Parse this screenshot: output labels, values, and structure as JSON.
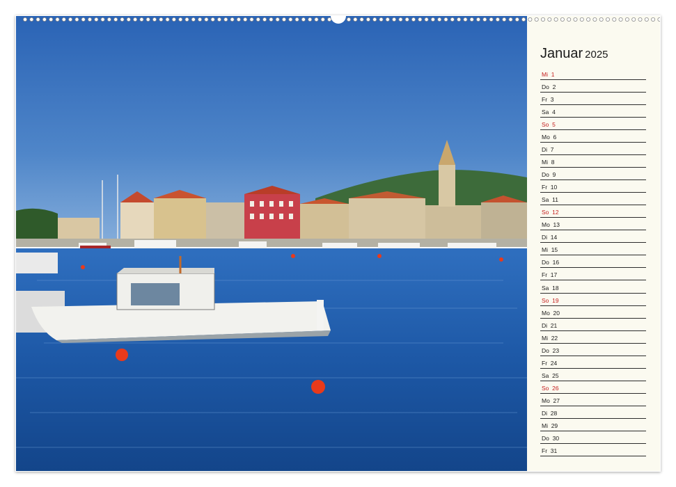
{
  "calendar": {
    "month": "Januar",
    "year": "2025",
    "accent_color": "#c41e1e",
    "days": [
      {
        "label": "Mi  1",
        "type": "holiday"
      },
      {
        "label": "Do  2",
        "type": "normal"
      },
      {
        "label": "Fr  3",
        "type": "normal"
      },
      {
        "label": "Sa  4",
        "type": "normal"
      },
      {
        "label": "So  5",
        "type": "sunday"
      },
      {
        "label": "Mo  6",
        "type": "normal"
      },
      {
        "label": "Di  7",
        "type": "normal"
      },
      {
        "label": "Mi  8",
        "type": "normal"
      },
      {
        "label": "Do  9",
        "type": "normal"
      },
      {
        "label": "Fr  10",
        "type": "normal"
      },
      {
        "label": "Sa  11",
        "type": "normal"
      },
      {
        "label": "So  12",
        "type": "sunday"
      },
      {
        "label": "Mo  13",
        "type": "normal"
      },
      {
        "label": "Di  14",
        "type": "normal"
      },
      {
        "label": "Mi  15",
        "type": "normal"
      },
      {
        "label": "Do  16",
        "type": "normal"
      },
      {
        "label": "Fr  17",
        "type": "normal"
      },
      {
        "label": "Sa  18",
        "type": "normal"
      },
      {
        "label": "So  19",
        "type": "sunday"
      },
      {
        "label": "Mo  20",
        "type": "normal"
      },
      {
        "label": "Di  21",
        "type": "normal"
      },
      {
        "label": "Mi  22",
        "type": "normal"
      },
      {
        "label": "Do  23",
        "type": "normal"
      },
      {
        "label": "Fr  24",
        "type": "normal"
      },
      {
        "label": "Sa  25",
        "type": "normal"
      },
      {
        "label": "So  26",
        "type": "sunday"
      },
      {
        "label": "Mo  27",
        "type": "normal"
      },
      {
        "label": "Di  28",
        "type": "normal"
      },
      {
        "label": "Mi  29",
        "type": "normal"
      },
      {
        "label": "Do  30",
        "type": "normal"
      },
      {
        "label": "Fr  31",
        "type": "normal"
      }
    ]
  }
}
